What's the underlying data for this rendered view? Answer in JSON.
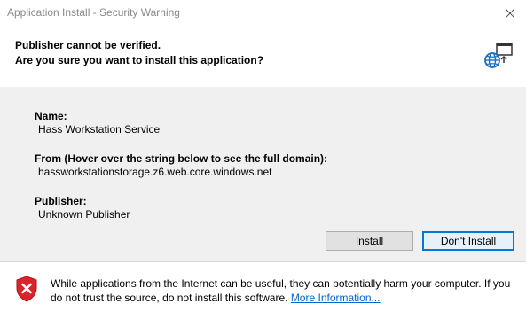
{
  "window": {
    "title": "Application Install - Security Warning"
  },
  "header": {
    "line1": "Publisher cannot be verified.",
    "line2": "Are you sure you want to install this application?",
    "icon": "network-app-icon"
  },
  "details": {
    "name_label": "Name:",
    "name_value": "Hass Workstation Service",
    "from_label": "From (Hover over the string below to see the full domain):",
    "from_value": "hassworkstationstorage.z6.web.core.windows.net",
    "publisher_label": "Publisher:",
    "publisher_value": "Unknown Publisher"
  },
  "buttons": {
    "install": "Install",
    "dont_install": "Don't Install"
  },
  "footer": {
    "warning_text": "While applications from the Internet can be useful, they can potentially harm your computer. If you do not trust the source, do not install this software. ",
    "more_info_link": "More Information...",
    "icon": "shield-error-icon"
  },
  "colors": {
    "details_bg": "#f0f0f0",
    "default_button_border": "#0078d7",
    "link": "#0066cc",
    "shield_red": "#d9252a"
  }
}
